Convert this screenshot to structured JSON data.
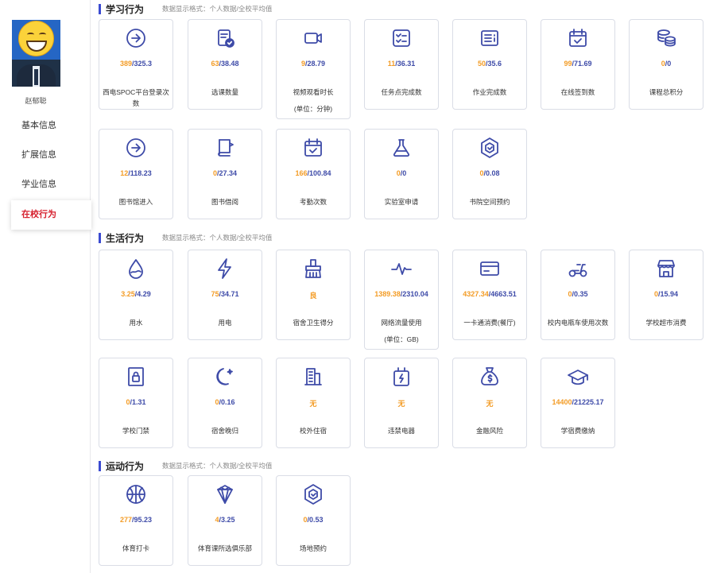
{
  "profile": {
    "name": "赵郁聪"
  },
  "menu": [
    {
      "label": "基本信息"
    },
    {
      "label": "扩展信息"
    },
    {
      "label": "学业信息"
    },
    {
      "label": "在校行为"
    }
  ],
  "sections": [
    {
      "title": "学习行为",
      "hint": "数据显示格式：个人数据/全校平均值",
      "cards": [
        {
          "icon": "arrow-circle-icon",
          "own": "389",
          "avg": "/325.3",
          "label": "西电SPOC平台登录次数"
        },
        {
          "icon": "selected-doc-icon",
          "own": "63",
          "avg": "/38.48",
          "label": "选课数量"
        },
        {
          "icon": "video-camera-icon",
          "own": "9",
          "avg": "/28.79",
          "label": "视频观看时长",
          "sub": "(单位：分钟)"
        },
        {
          "icon": "task-checklist-icon",
          "own": "11",
          "avg": "/36.31",
          "label": "任务点完成数"
        },
        {
          "icon": "homework-list-icon",
          "own": "50",
          "avg": "/35.6",
          "label": "作业完成数"
        },
        {
          "icon": "calendar-check-icon",
          "own": "99",
          "avg": "/71.69",
          "label": "在线签到数"
        },
        {
          "icon": "coins-stack-icon",
          "own": "0",
          "avg": "/0",
          "label": "课程总积分"
        },
        {
          "icon": "arrow-circle-icon",
          "own": "12",
          "avg": "/118.23",
          "label": "图书馆进入"
        },
        {
          "icon": "book-borrow-icon",
          "own": "0",
          "avg": "/27.34",
          "label": "图书借阅"
        },
        {
          "icon": "attendance-calendar-icon",
          "own": "166",
          "avg": "/100.84",
          "label": "考勤次数"
        },
        {
          "icon": "flask-icon",
          "own": "0",
          "avg": "/0",
          "label": "实验室申请"
        },
        {
          "icon": "hexagon-badge-icon",
          "own": "0",
          "avg": "/0.08",
          "label": "书院空间预约"
        }
      ]
    },
    {
      "title": "生活行为",
      "hint": "数据显示格式：个人数据/全校平均值",
      "cards": [
        {
          "icon": "water-drop-icon",
          "own": "3.25",
          "avg": "/4.29",
          "label": "用水"
        },
        {
          "icon": "lightning-icon",
          "own": "75",
          "avg": "/34.71",
          "label": "用电"
        },
        {
          "icon": "broom-icon",
          "own": "良",
          "avg": "",
          "label": "宿舍卫生得分"
        },
        {
          "icon": "pulse-wave-icon",
          "own": "1389.38",
          "avg": "/2310.04",
          "label": "网络流量使用",
          "sub": "(单位：GB)"
        },
        {
          "icon": "card-icon",
          "own": "4327.34",
          "avg": "/4663.51",
          "label": "一卡通消费(餐厅)"
        },
        {
          "icon": "scooter-icon",
          "own": "0",
          "avg": "/0.35",
          "label": "校内电瓶车使用次数"
        },
        {
          "icon": "shop-icon",
          "own": "0",
          "avg": "/15.94",
          "label": "学校超市消费"
        },
        {
          "icon": "gate-lock-icon",
          "own": "0",
          "avg": "/1.31",
          "label": "学校门禁"
        },
        {
          "icon": "moon-star-icon",
          "own": "0",
          "avg": "/0.16",
          "label": "宿舍晚归"
        },
        {
          "icon": "building-icon",
          "own": "无",
          "avg": "",
          "label": "校外住宿"
        },
        {
          "icon": "plug-icon",
          "own": "无",
          "avg": "",
          "label": "违禁电器"
        },
        {
          "icon": "money-bag-icon",
          "own": "无",
          "avg": "",
          "label": "金融风险"
        },
        {
          "icon": "graduation-cap-icon",
          "own": "14400",
          "avg": "/21225.17",
          "label": "学宿费缴纳"
        }
      ]
    },
    {
      "title": "运动行为",
      "hint": "数据显示格式：个人数据/全校平均值",
      "cards": [
        {
          "icon": "basketball-icon",
          "own": "277",
          "avg": "/95.23",
          "label": "体育打卡"
        },
        {
          "icon": "diamond-badge-icon",
          "own": "4",
          "avg": "/3.25",
          "label": "体育课所选俱乐部"
        },
        {
          "icon": "hexagon-badge-icon",
          "own": "0",
          "avg": "/0.53",
          "label": "场地预约"
        }
      ]
    }
  ],
  "colors": {
    "accent": "#3b4bd1",
    "own_value": "#f39c26",
    "avg_value": "#3e4ba8",
    "active_menu": "#d6202e"
  }
}
